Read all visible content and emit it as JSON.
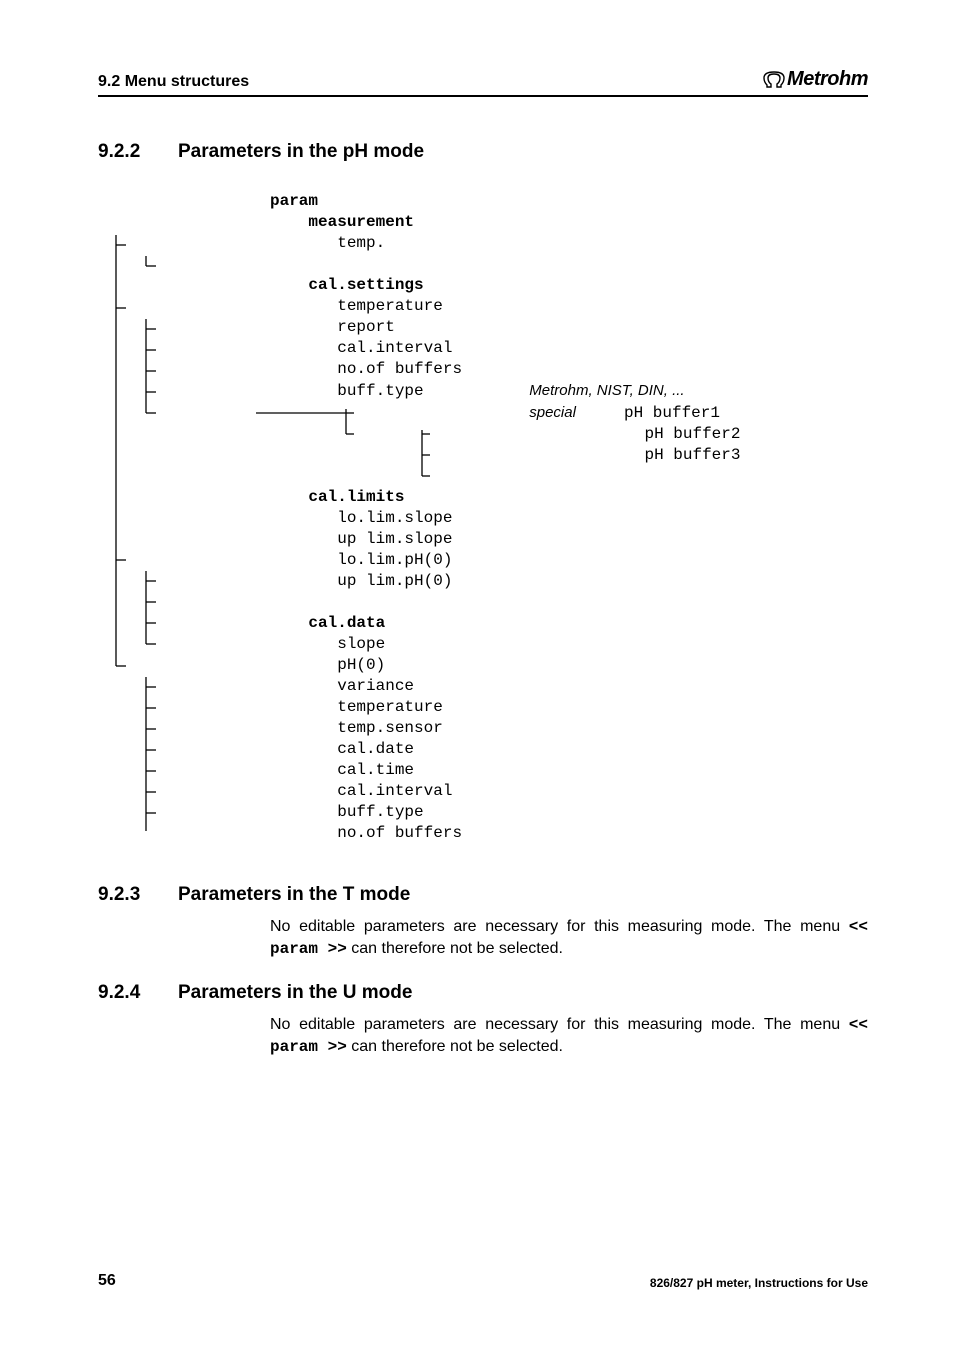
{
  "header": {
    "section": "9.2 Menu structures",
    "brand": "Metrohm"
  },
  "s922": {
    "num": "9.2.2",
    "title": "Parameters in the pH mode"
  },
  "tree": {
    "root": "param",
    "g1": {
      "title": "measurement",
      "i0": "temp."
    },
    "g2": {
      "title": "cal.settings",
      "i0": "temperature",
      "i1": "report",
      "i2": "cal.interval",
      "i3": "no.of buffers",
      "i4": "buff.type",
      "bt_opt0": "Metrohm, NIST, DIN, ...",
      "bt_opt1": "special",
      "sp0": "pH buffer1",
      "sp1": "pH buffer2",
      "sp2": "pH buffer3"
    },
    "g3": {
      "title": "cal.limits",
      "i0": "lo.lim.slope",
      "i1": "up lim.slope",
      "i2": "lo.lim.pH(0)",
      "i3": "up lim.pH(0)"
    },
    "g4": {
      "title": "cal.data",
      "i0": "slope",
      "i1": "pH(0)",
      "i2": "variance",
      "i3": "temperature",
      "i4": "temp.sensor",
      "i5": "cal.date",
      "i6": "cal.time",
      "i7": "cal.interval",
      "i8": "buff.type",
      "i9": "no.of buffers"
    }
  },
  "s923": {
    "num": "9.2.3",
    "title": "Parameters in the T mode",
    "body_a": "No editable parameters are necessary for this measuring mode. The menu ",
    "body_mono": "<< param >>",
    "body_b": " can therefore not be selected."
  },
  "s924": {
    "num": "9.2.4",
    "title": "Parameters in the U mode",
    "body_a": "No editable parameters are necessary for this measuring mode. The menu ",
    "body_mono": "<< param >>",
    "body_b": " can therefore not be selected."
  },
  "footer": {
    "page": "56",
    "doc": "826/827 pH meter, Instructions for Use"
  }
}
